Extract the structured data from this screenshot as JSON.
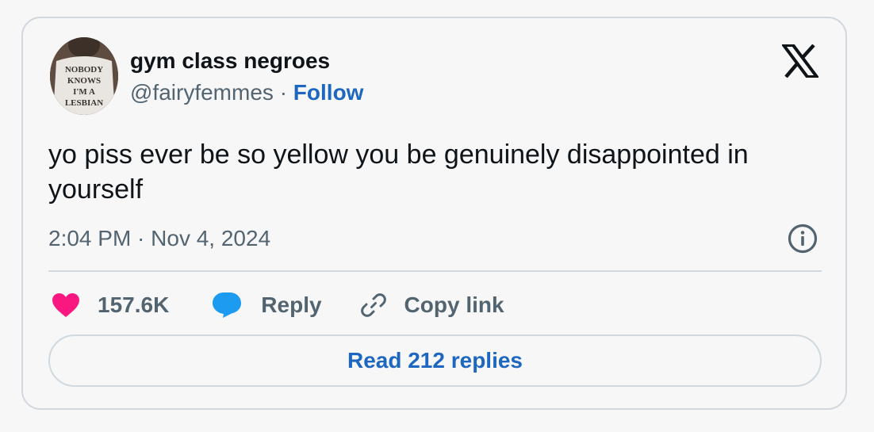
{
  "author": {
    "display_name": "gym class negroes",
    "handle": "@fairyfemmes",
    "separator": "·",
    "follow_label": "Follow",
    "avatar_shirt_text": [
      "NOBODY",
      "KNOWS",
      "I'M A",
      "LESBIAN"
    ]
  },
  "tweet": {
    "text": "yo piss ever be so yellow you be genuinely disappointed in yourself",
    "timestamp": "2:04 PM · Nov 4, 2024"
  },
  "actions": {
    "like_count": "157.6K",
    "reply_label": "Reply",
    "copy_link_label": "Copy link"
  },
  "footer": {
    "read_replies_label": "Read 212 replies"
  },
  "colors": {
    "like_heart": "#f91880",
    "reply_bubble": "#1d9bf0",
    "link_blue": "#1d67c1",
    "muted_text": "#536471"
  },
  "icons": [
    "x-logo-icon",
    "info-icon",
    "heart-icon",
    "reply-bubble-icon",
    "link-icon"
  ]
}
